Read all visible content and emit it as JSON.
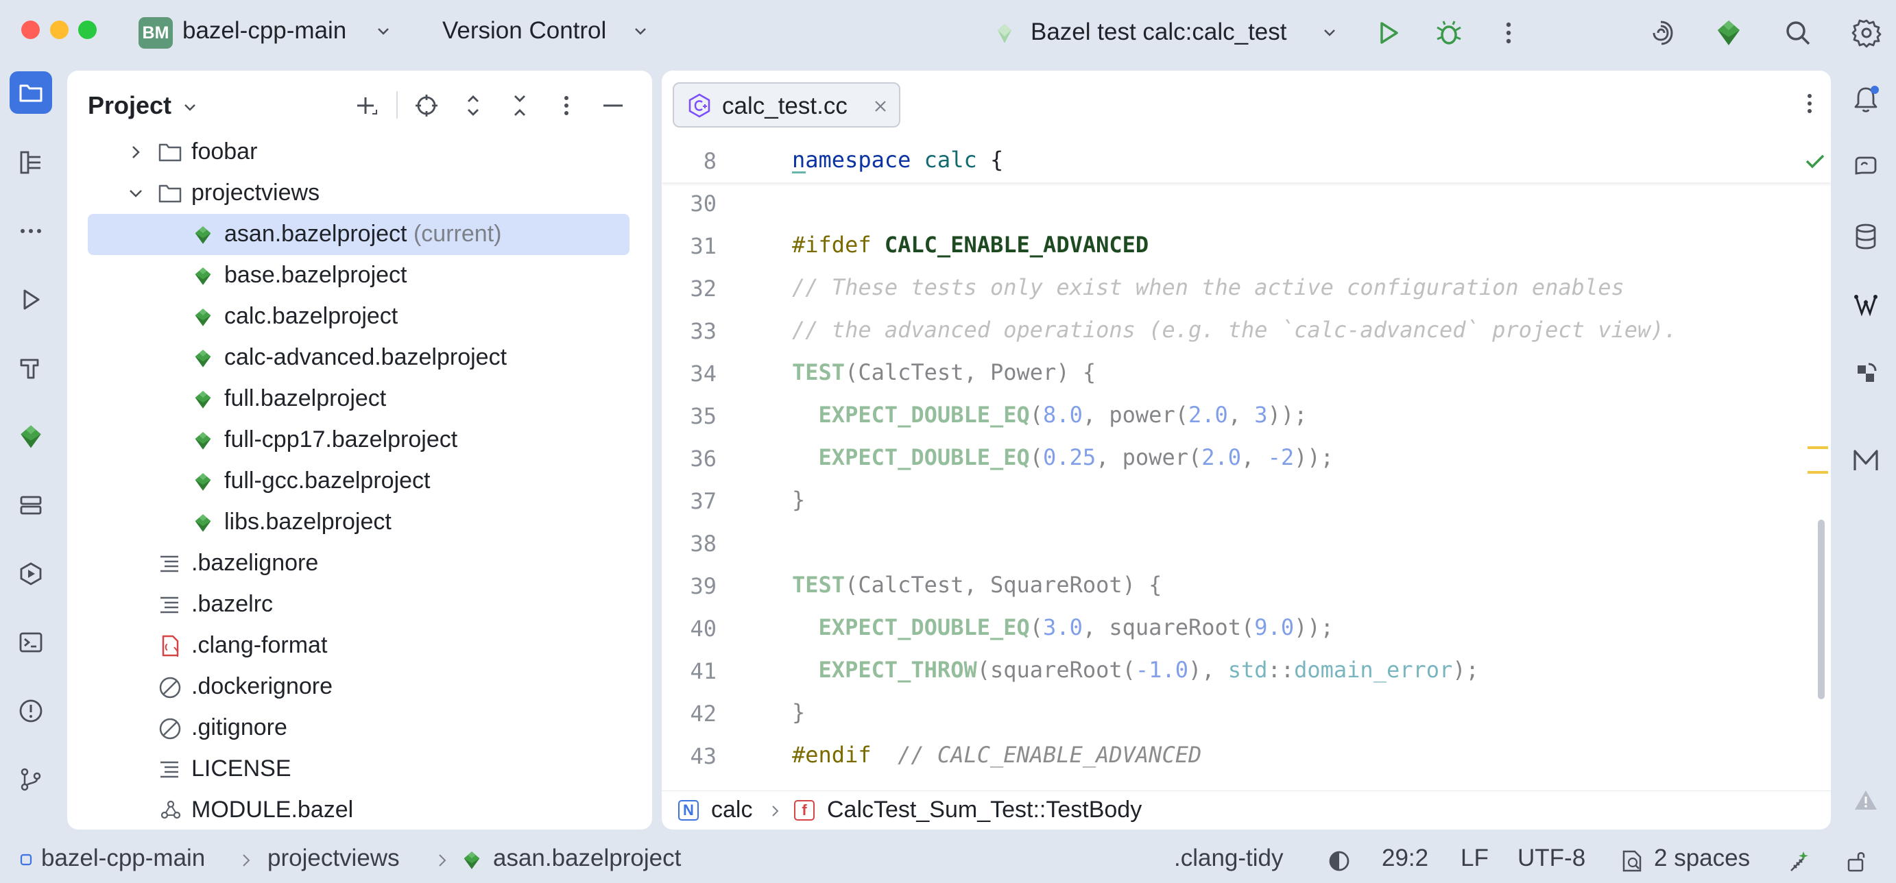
{
  "titlebar": {
    "project_badge": "BM",
    "project_name": "bazel-cpp-main",
    "vcs_menu": "Version Control",
    "run_config": "Bazel test calc:calc_test"
  },
  "project_panel": {
    "title": "Project",
    "tree": [
      {
        "label": "foobar",
        "type": "folder",
        "expanded": false
      },
      {
        "label": "projectviews",
        "type": "folder",
        "expanded": true
      },
      {
        "label": "asan.bazelproject",
        "suffix": "(current)",
        "type": "bazel",
        "selected": true
      },
      {
        "label": "base.bazelproject",
        "type": "bazel"
      },
      {
        "label": "calc.bazelproject",
        "type": "bazel"
      },
      {
        "label": "calc-advanced.bazelproject",
        "type": "bazel"
      },
      {
        "label": "full.bazelproject",
        "type": "bazel"
      },
      {
        "label": "full-cpp17.bazelproject",
        "type": "bazel"
      },
      {
        "label": "full-gcc.bazelproject",
        "type": "bazel"
      },
      {
        "label": "libs.bazelproject",
        "type": "bazel"
      },
      {
        "label": ".bazelignore",
        "type": "text"
      },
      {
        "label": ".bazelrc",
        "type": "text"
      },
      {
        "label": ".clang-format",
        "type": "config"
      },
      {
        "label": ".dockerignore",
        "type": "ignore"
      },
      {
        "label": ".gitignore",
        "type": "ignore"
      },
      {
        "label": "LICENSE",
        "type": "text"
      },
      {
        "label": "MODULE.bazel",
        "type": "module"
      }
    ]
  },
  "editor": {
    "tab_label": "calc_test.cc",
    "sticky_line": {
      "number": "8",
      "code": "namespace calc {"
    },
    "lines": [
      {
        "number": "30"
      },
      {
        "number": "31",
        "code": "#ifdef CALC_ENABLE_ADVANCED"
      },
      {
        "number": "32",
        "code": "// These tests only exist when the active configuration enables"
      },
      {
        "number": "33",
        "code": "// the advanced operations (e.g. the `calc-advanced` project view)."
      },
      {
        "number": "34",
        "code": "TEST(CalcTest, Power) {"
      },
      {
        "number": "35",
        "code": "  EXPECT_DOUBLE_EQ(8.0, power(2.0, 3));"
      },
      {
        "number": "36",
        "code": "  EXPECT_DOUBLE_EQ(0.25, power(2.0, -2));"
      },
      {
        "number": "37",
        "code": "}"
      },
      {
        "number": "38"
      },
      {
        "number": "39",
        "code": "TEST(CalcTest, SquareRoot) {"
      },
      {
        "number": "40",
        "code": "  EXPECT_DOUBLE_EQ(3.0, squareRoot(9.0));"
      },
      {
        "number": "41",
        "code": "  EXPECT_THROW(squareRoot(-1.0), std::domain_error);"
      },
      {
        "number": "42",
        "code": "}"
      },
      {
        "number": "43",
        "code": "#endif  // CALC_ENABLE_ADVANCED"
      }
    ],
    "breadcrumbs": {
      "namespace_badge": "N",
      "namespace": "calc",
      "function_badge": "f",
      "function": "CalcTest_Sum_Test::TestBody"
    }
  },
  "statusbar": {
    "path": [
      "bazel-cpp-main",
      "projectviews",
      "asan.bazelproject"
    ],
    "linter": ".clang-tidy",
    "caret": "29:2",
    "line_sep": "LF",
    "encoding": "UTF-8",
    "indent": "2 spaces"
  },
  "colors": {
    "accent": "#3d74e0",
    "bazel_green": "#43a047",
    "selection": "#d5e1fb",
    "chrome_bg": "#dfe6ef"
  }
}
